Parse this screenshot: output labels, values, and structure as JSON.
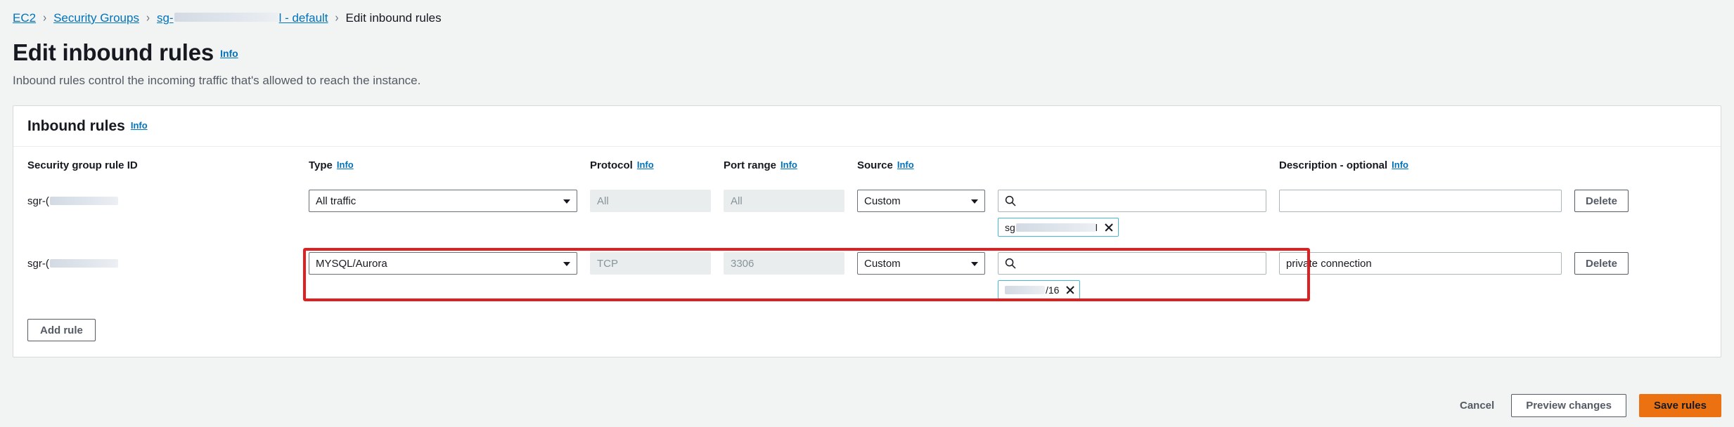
{
  "breadcrumb": {
    "items": [
      {
        "label": "EC2",
        "type": "link"
      },
      {
        "label": "Security Groups",
        "type": "link"
      },
      {
        "label_prefix": "sg-",
        "label_suffix": "l - default",
        "type": "link-redacted"
      },
      {
        "label": "Edit inbound rules",
        "type": "current"
      }
    ],
    "separator": "›"
  },
  "page": {
    "title": "Edit inbound rules",
    "info_label": "Info",
    "subtitle": "Inbound rules control the incoming traffic that's allowed to reach the instance."
  },
  "panel": {
    "title": "Inbound rules",
    "info_label": "Info"
  },
  "table": {
    "columns": [
      {
        "label": "Security group rule ID",
        "info": ""
      },
      {
        "label": "Type",
        "info": "Info"
      },
      {
        "label": "Protocol",
        "info": "Info"
      },
      {
        "label": "Port range",
        "info": "Info"
      },
      {
        "label": "Source",
        "info": "Info"
      },
      {
        "label": "Description - optional",
        "info": "Info"
      }
    ],
    "rows": [
      {
        "rule_id_prefix": "sgr-(",
        "type": "All traffic",
        "protocol": "All",
        "port_range": "All",
        "source_type": "Custom",
        "source_search_value": "",
        "source_token_prefix": "sg",
        "source_token_suffix": "l",
        "description": "",
        "delete_label": "Delete"
      },
      {
        "rule_id_prefix": "sgr-(",
        "type": "MYSQL/Aurora",
        "protocol": "TCP",
        "port_range": "3306",
        "source_type": "Custom",
        "source_search_value": "",
        "source_token_prefix": "",
        "source_token_suffix": "/16",
        "description": "private connection",
        "delete_label": "Delete"
      }
    ],
    "add_rule_label": "Add rule"
  },
  "footer": {
    "cancel_label": "Cancel",
    "preview_label": "Preview changes",
    "save_label": "Save rules"
  },
  "icons": {
    "search": "search-icon",
    "chevron_down": "chevron-down-icon",
    "close": "close-icon"
  },
  "colors": {
    "link": "#0073bb",
    "primary_button": "#ec7211",
    "annotation": "#e02020",
    "page_background": "#f2f3f3",
    "token_border": "#44b9d6"
  }
}
